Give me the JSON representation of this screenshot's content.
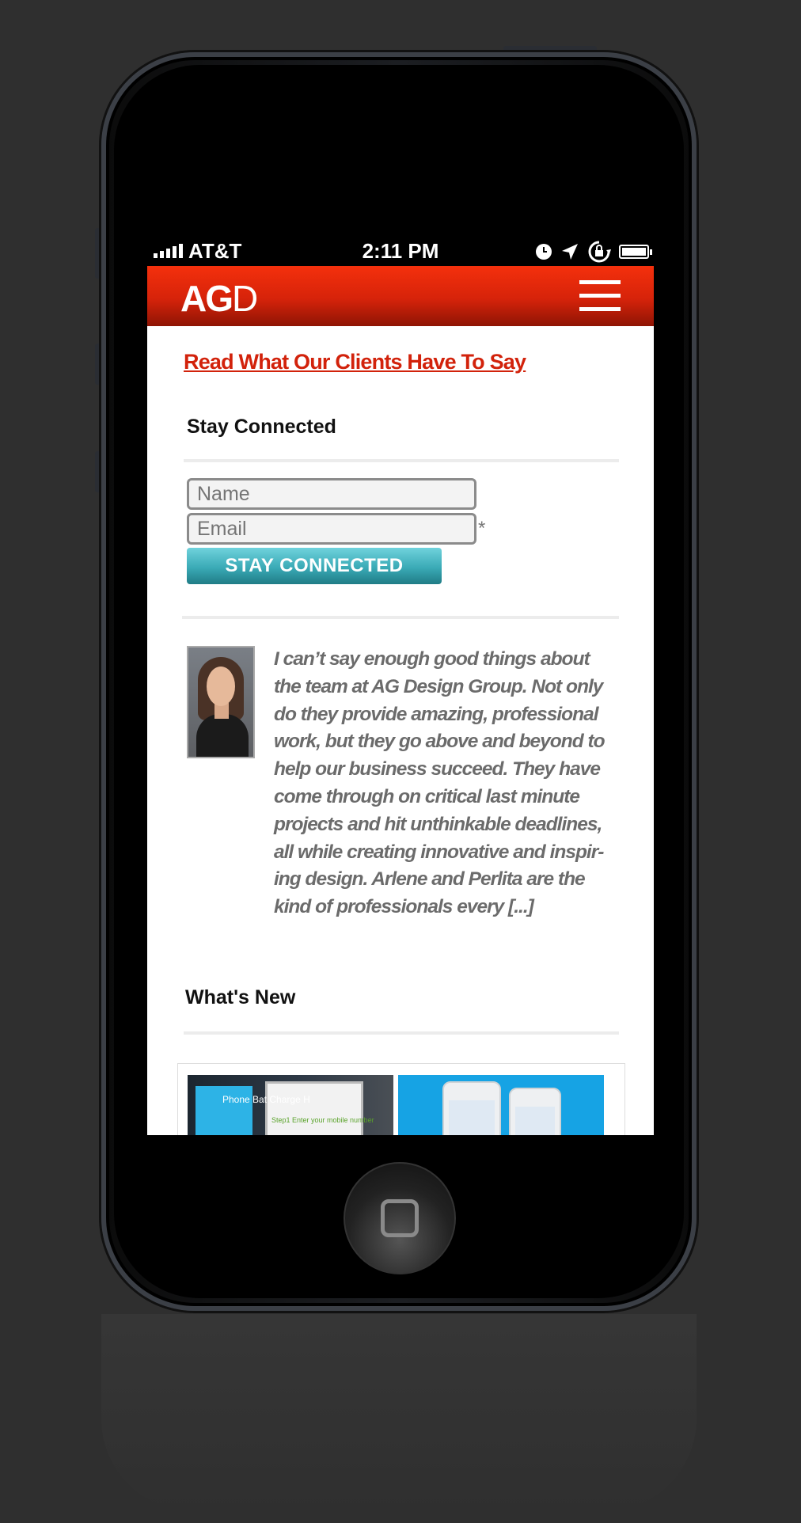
{
  "status_bar": {
    "carrier": "AT&T",
    "time": "2:11 PM",
    "icons": [
      "signal-icon",
      "clock-icon",
      "location-arrow-icon",
      "rotation-lock-icon",
      "battery-icon"
    ]
  },
  "header": {
    "logo_bold": "AG",
    "logo_thin": "D",
    "menu_icon": "hamburger-menu-icon",
    "background_color": "#e02a0b"
  },
  "main": {
    "clients_link": "Read What Our Clients Have To Say",
    "stay_connected": {
      "title": "Stay Connected",
      "name_placeholder": "Name",
      "email_placeholder": "Email",
      "required_marker": "*",
      "submit_label": "STAY CONNECTED",
      "button_color": "#3aaab6"
    },
    "testimonial": {
      "quote": "I can’t say enough good things about the team at AG Design Group. Not only do they provide amazing, professional work, but they go above and beyond to help our business succeed. They have come through on critical last minute projects and hit unthinkable deadlines, all while creating innovative and inspir-ing design. Arlene and Perlita are the kind of professionals every [...]"
    },
    "whats_new": {
      "title": "What's New",
      "thumbs": [
        {
          "caption": "Phone Bat Charge H",
          "step": "Step1 Enter your mobile number"
        },
        {
          "caption": ""
        }
      ]
    }
  },
  "colors": {
    "accent_red": "#d2220b",
    "quote_gray": "#6b6b6b"
  }
}
